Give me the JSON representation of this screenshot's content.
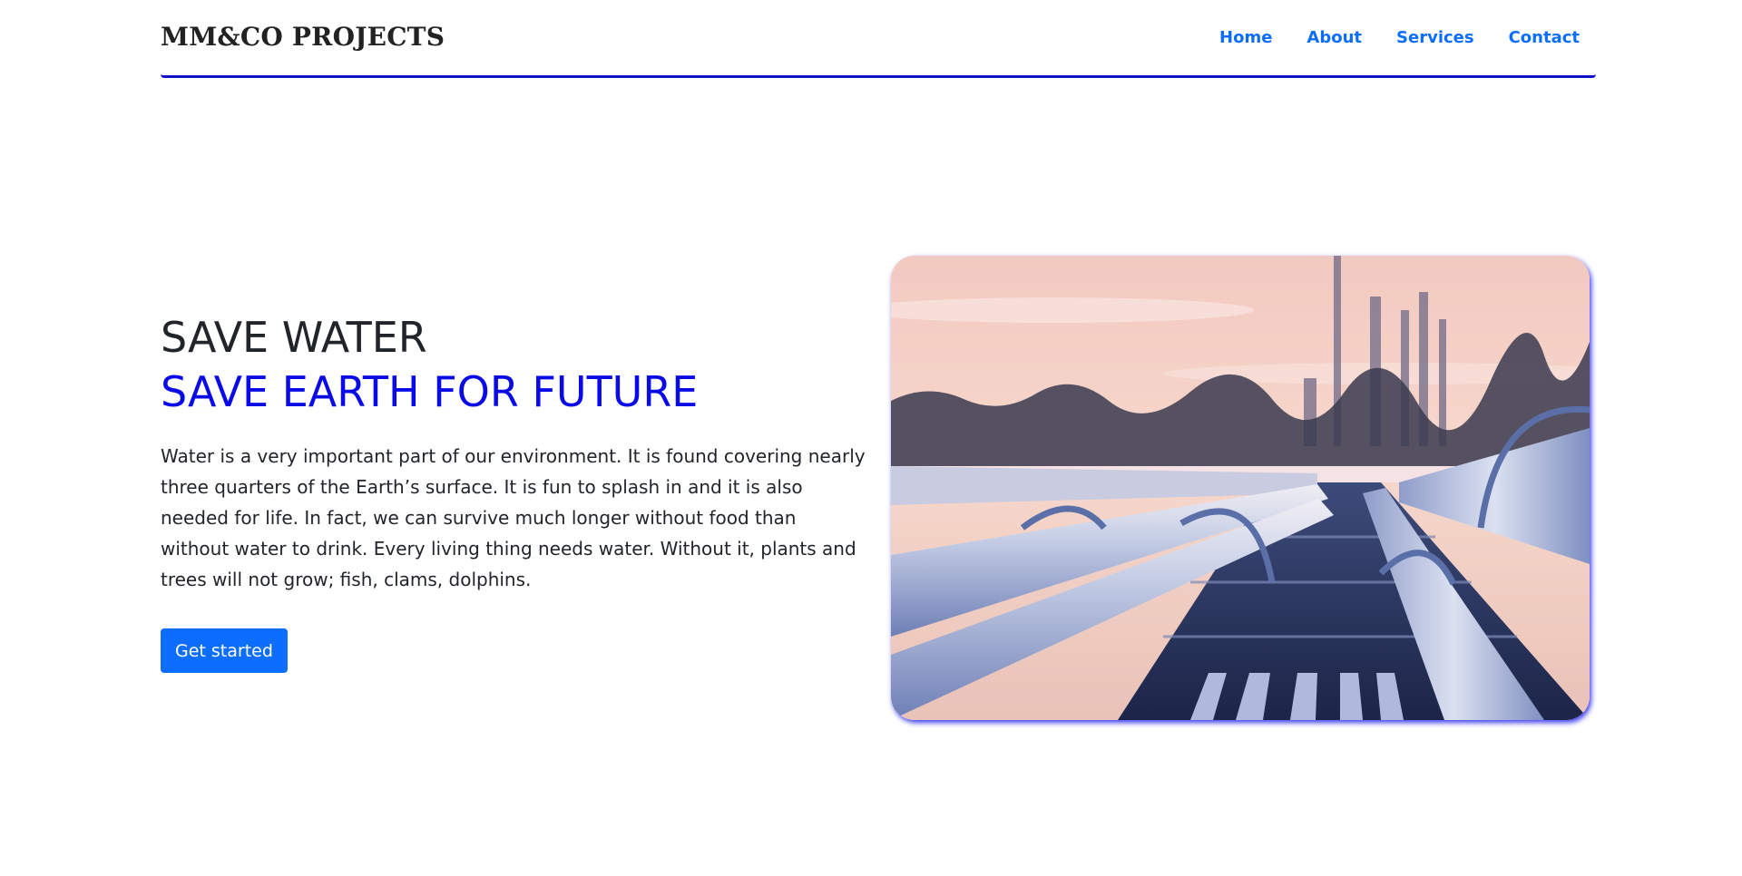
{
  "header": {
    "brand": "MM&CO PROJECTS",
    "nav": [
      "Home",
      "About",
      "Services",
      "Contact"
    ]
  },
  "hero": {
    "title_line1": "SAVE WATER",
    "title_line2": "SAVE EARTH FOR FUTURE",
    "paragraph": "Water is a very important part of our environment. It is found covering nearly three quarters of the Earth’s surface. It is fun to splash in and it is also needed for life. In fact, we can survive much longer without food than without water to drink. Every living thing needs water. Without it, plants and trees will not grow; fish, clams, dolphins.",
    "cta_label": "Get started",
    "image": "pipeline-sunset-photo"
  },
  "colors": {
    "accent_blue": "#0d6efd",
    "headline_blue": "#0a0ae6",
    "divider": "#1010cc"
  }
}
